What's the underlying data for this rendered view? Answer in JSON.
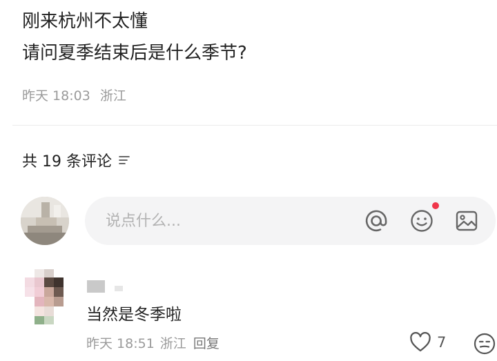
{
  "post": {
    "lines": [
      "刚来杭州不太懂",
      "请问夏季结束后是什么季节?"
    ],
    "time": "昨天 18:03",
    "location": "浙江"
  },
  "comments_section": {
    "count_label": "共 19 条评论",
    "sort_icon": "sort-lines-icon"
  },
  "input_bar": {
    "placeholder": "说点什么...",
    "icons": [
      "at-icon",
      "emoji-icon",
      "image-icon"
    ],
    "notification_color": "#f0364a"
  },
  "comments": [
    {
      "text": "当然是冬季啦",
      "time": "昨天 18:51",
      "location": "浙江",
      "reply_label": "回复",
      "likes": "7"
    }
  ],
  "colors": {
    "text_primary": "#222222",
    "text_secondary": "#9a9a9a",
    "input_bg": "#f4f4f5",
    "accent_red": "#f0364a"
  }
}
